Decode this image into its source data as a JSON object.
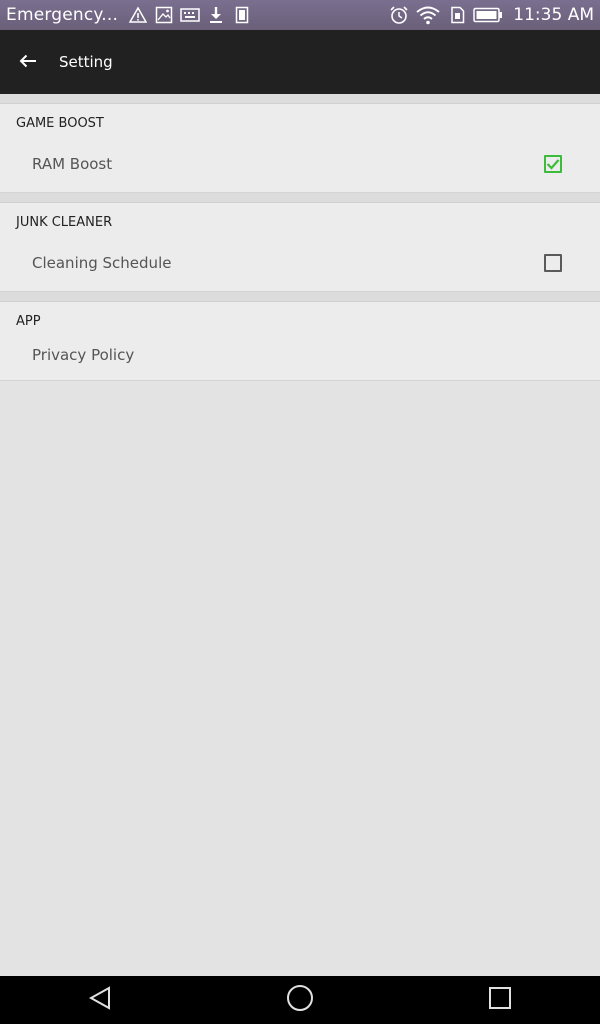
{
  "status_bar": {
    "carrier": "Emergency...",
    "time": "11:35 AM",
    "left_icons": [
      "warning-icon",
      "image-icon",
      "keyboard-icon",
      "download-icon",
      "sim-icon"
    ],
    "right_icons": [
      "alarm-icon",
      "wifi-icon",
      "sim-card-icon",
      "battery-icon"
    ]
  },
  "app_bar": {
    "back_icon": "arrow-left-icon",
    "title": "Setting"
  },
  "sections": [
    {
      "header": "GAME BOOST",
      "rows": [
        {
          "label": "RAM Boost",
          "checked": true
        }
      ]
    },
    {
      "header": "JUNK CLEANER",
      "rows": [
        {
          "label": "Cleaning Schedule",
          "checked": false
        }
      ]
    },
    {
      "header": "APP",
      "rows": [
        {
          "label": "Privacy Policy"
        }
      ]
    }
  ],
  "colors": {
    "check_accent": "#3dbb3a",
    "app_bar": "#212121",
    "status_bar": "#6f6582",
    "background": "#e3e3e3"
  },
  "nav_bar": {
    "buttons": [
      "back-triangle-icon",
      "home-circle-icon",
      "recents-square-icon"
    ]
  }
}
